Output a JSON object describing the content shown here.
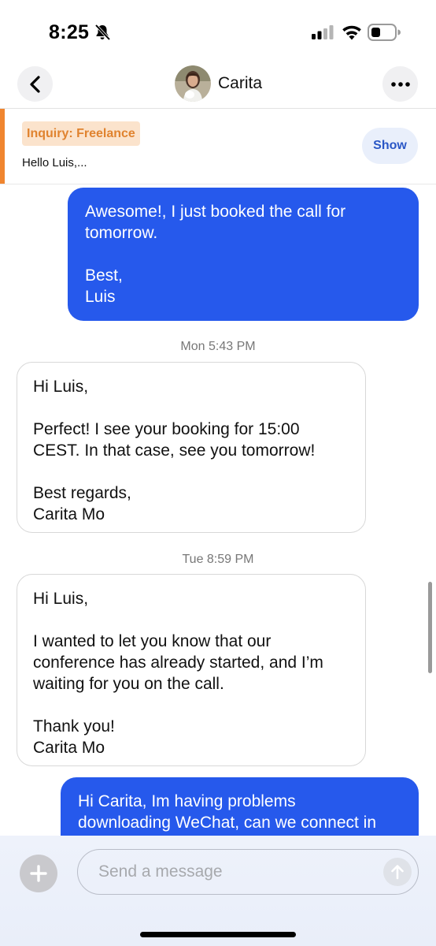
{
  "status_bar": {
    "time": "8:25"
  },
  "header": {
    "contact_name": "Carita"
  },
  "inquiry": {
    "badge": "Inquiry: Freelance",
    "preview": "Hello Luis,...",
    "show_label": "Show",
    "accent_color": "#f0852f"
  },
  "messages": [
    {
      "direction": "outgoing",
      "text": "Awesome!, I just booked the call for\ntomorrow.\n\nBest,\nLuis"
    },
    {
      "direction": "timestamp",
      "text": "Mon 5:43 PM"
    },
    {
      "direction": "incoming",
      "text": "Hi Luis,\n\nPerfect! I see your booking for 15:00\nCEST. In that case, see you tomorrow!\n\nBest regards,\nCarita Mo"
    },
    {
      "direction": "timestamp",
      "text": "Tue 8:59 PM"
    },
    {
      "direction": "incoming",
      "text": "Hi Luis,\n\nI wanted to let you know that our\nconference has already started, and I’m\nwaiting for you on the call.\n\nThank you!\nCarita Mo"
    },
    {
      "direction": "outgoing",
      "text": "Hi Carita, Im having problems\ndownloading WeChat, can we connect in"
    }
  ],
  "composer": {
    "placeholder": "Send a message",
    "value": ""
  },
  "colors": {
    "outgoing_bubble": "#2659ec",
    "badge_text": "#e0832f",
    "show_text": "#2a57c6"
  },
  "icons": {
    "status": [
      "bell-slash-icon",
      "signal-icon",
      "wifi-icon",
      "battery-icon"
    ],
    "header": [
      "back-chevron-icon",
      "more-dots-icon"
    ],
    "composer": [
      "plus-icon",
      "send-arrow-icon"
    ]
  }
}
